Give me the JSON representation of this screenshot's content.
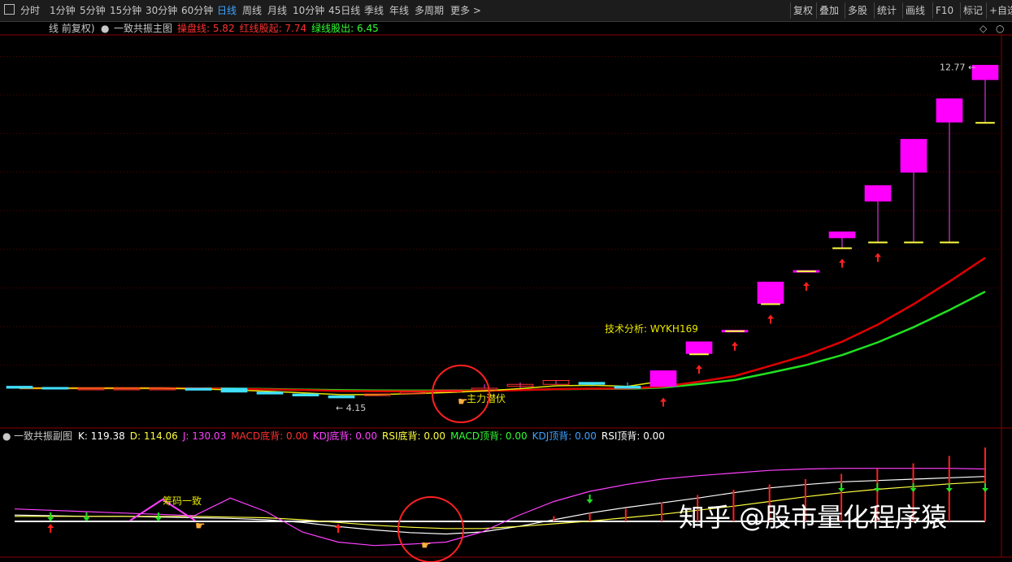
{
  "toolbar": {
    "periods": [
      "分时",
      "1分钟",
      "5分钟",
      "15分钟",
      "30分钟",
      "60分钟",
      "日线",
      "周线",
      "月线",
      "10分钟",
      "45日线",
      "季线",
      "年线",
      "多周期",
      "更多 >"
    ],
    "active_period": "日线",
    "right_buttons": [
      "复权",
      "叠加",
      "多股",
      "统计",
      "画线",
      "F10",
      "标记",
      "+自选"
    ]
  },
  "main_header": {
    "prefix": "线 前复权)",
    "indicator_name": "一致共振主图",
    "items": [
      {
        "label": "操盘线: 5.82",
        "color": "#ff3030"
      },
      {
        "label": "红线股起: 7.74",
        "color": "#ff3030"
      },
      {
        "label": "绿线股出: 6.45",
        "color": "#30ff30"
      }
    ]
  },
  "sub_header": {
    "indicator_name": "一致共振副图",
    "items": [
      {
        "label": "K: 119.38",
        "color": "#ffffff"
      },
      {
        "label": "D: 114.06",
        "color": "#ffff40"
      },
      {
        "label": "J: 130.03",
        "color": "#ff40ff"
      },
      {
        "label": "MACD底背: 0.00",
        "color": "#ff3030"
      },
      {
        "label": "KDJ底背: 0.00",
        "color": "#ff40ff"
      },
      {
        "label": "RSI底背: 0.00",
        "color": "#ffff40"
      },
      {
        "label": "MACD顶背: 0.00",
        "color": "#30ff30"
      },
      {
        "label": "KDJ顶背: 0.00",
        "color": "#3fa3ff"
      },
      {
        "label": "RSI顶背: 0.00",
        "color": "#ffffff"
      }
    ]
  },
  "annotations": {
    "high_price": "12.77",
    "low_price": "4.15",
    "tech_analysis": "技术分析: WYKH169",
    "main_force": "主力潜伏",
    "chip_consistent": "筹码一致"
  },
  "watermark": "知乎 @股市量化程序猿",
  "chart_data": [
    {
      "type": "candlestick",
      "title": "一致共振主图",
      "series": [
        {
          "name": "操盘线",
          "color": "#e8e800"
        },
        {
          "name": "红线股起",
          "color": "#e00000"
        },
        {
          "name": "绿线股出",
          "color": "#20e020"
        }
      ],
      "candles": [
        {
          "o": 4.45,
          "c": 4.4,
          "h": 4.45,
          "l": 4.4
        },
        {
          "o": 4.42,
          "c": 4.4,
          "h": 4.42,
          "l": 4.4
        },
        {
          "o": 4.4,
          "c": 4.4,
          "h": 4.4,
          "l": 4.4
        },
        {
          "o": 4.4,
          "c": 4.4,
          "h": 4.4,
          "l": 4.4
        },
        {
          "o": 4.4,
          "c": 4.4,
          "h": 4.4,
          "l": 4.4
        },
        {
          "o": 4.4,
          "c": 4.35,
          "h": 4.4,
          "l": 4.35
        },
        {
          "o": 4.4,
          "c": 4.3,
          "h": 4.4,
          "l": 4.3
        },
        {
          "o": 4.3,
          "c": 4.25,
          "h": 4.3,
          "l": 4.25
        },
        {
          "o": 4.25,
          "c": 4.2,
          "h": 4.25,
          "l": 4.2
        },
        {
          "o": 4.2,
          "c": 4.15,
          "h": 4.2,
          "l": 4.15
        },
        {
          "o": 4.25,
          "c": 4.25,
          "h": 4.25,
          "l": 4.25
        },
        {
          "o": 4.3,
          "c": 4.3,
          "h": 4.3,
          "l": 4.3
        },
        {
          "o": 4.35,
          "c": 4.35,
          "h": 4.35,
          "l": 4.35
        },
        {
          "o": 4.4,
          "c": 4.4,
          "h": 4.5,
          "l": 4.4
        },
        {
          "o": 4.45,
          "c": 4.5,
          "h": 4.55,
          "l": 4.4
        },
        {
          "o": 4.5,
          "c": 4.6,
          "h": 4.6,
          "l": 4.5
        },
        {
          "o": 4.55,
          "c": 4.5,
          "h": 4.55,
          "l": 4.45
        },
        {
          "o": 4.45,
          "c": 4.4,
          "h": 4.55,
          "l": 4.4
        },
        {
          "o": 4.45,
          "c": 4.85,
          "h": 4.85,
          "l": 4.45
        },
        {
          "o": 5.3,
          "c": 5.6,
          "h": 5.6,
          "l": 5.3
        },
        {
          "o": 5.9,
          "c": 5.9,
          "h": 5.9,
          "l": 5.9
        },
        {
          "o": 6.6,
          "c": 7.15,
          "h": 7.15,
          "l": 6.6
        },
        {
          "o": 7.45,
          "c": 7.45,
          "h": 7.45,
          "l": 7.45
        },
        {
          "o": 8.3,
          "c": 8.45,
          "h": 8.45,
          "l": 8.05
        },
        {
          "o": 9.25,
          "c": 9.65,
          "h": 9.65,
          "l": 8.2
        },
        {
          "o": 10.0,
          "c": 10.85,
          "h": 10.85,
          "l": 8.2
        },
        {
          "o": 11.3,
          "c": 11.9,
          "h": 11.9,
          "l": 8.2
        },
        {
          "o": 12.4,
          "c": 12.77,
          "h": 12.77,
          "l": 11.3
        }
      ],
      "ylim": [
        4.0,
        13.2
      ]
    },
    {
      "type": "line",
      "title": "一致共振副图",
      "series": [
        {
          "name": "K",
          "color": "#ffffff",
          "values": [
            35,
            34,
            33,
            33,
            32,
            31,
            30,
            28,
            24,
            18,
            13,
            9,
            7,
            10,
            18,
            28,
            38,
            46,
            53,
            60,
            68,
            75,
            80,
            84,
            86,
            88,
            90,
            92
          ]
        },
        {
          "name": "D",
          "color": "#ffff40",
          "values": [
            33,
            33,
            33,
            33,
            33,
            33,
            32,
            31,
            28,
            24,
            20,
            17,
            15,
            15,
            18,
            22,
            26,
            31,
            36,
            42,
            48,
            55,
            62,
            68,
            73,
            77,
            81,
            84
          ]
        },
        {
          "name": "J",
          "color": "#ff40ff",
          "values": [
            44,
            42,
            40,
            38,
            36,
            34,
            60,
            40,
            10,
            -5,
            -10,
            -8,
            -5,
            10,
            34,
            55,
            70,
            80,
            88,
            93,
            97,
            101,
            103,
            104,
            104,
            104,
            104,
            103
          ]
        }
      ],
      "ylim": [
        -20,
        130
      ]
    }
  ]
}
